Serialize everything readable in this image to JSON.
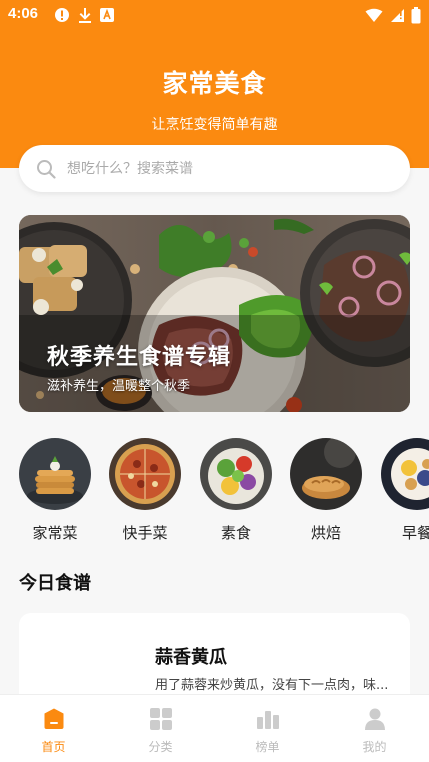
{
  "status_bar": {
    "time": "4:06"
  },
  "header": {
    "title": "家常美食",
    "subtitle": "让烹饪变得简单有趣"
  },
  "search": {
    "placeholder": "想吃什么？搜索菜谱"
  },
  "banner": {
    "title": "秋季养生食谱专辑",
    "subtitle": "滋补养生，温暖整个秋季"
  },
  "categories": [
    {
      "label": "家常菜",
      "icon": "pancake-stack"
    },
    {
      "label": "快手菜",
      "icon": "pizza"
    },
    {
      "label": "素食",
      "icon": "vegetable-bowl"
    },
    {
      "label": "烘焙",
      "icon": "bread"
    },
    {
      "label": "早餐",
      "icon": "breakfast-plate"
    }
  ],
  "today": {
    "section_title": "今日食谱",
    "recipe": {
      "name": "蒜香黄瓜",
      "description": "用了蒜蓉来炒黄瓜，没有下一点肉，味..."
    }
  },
  "tabbar": {
    "items": [
      {
        "label": "首页",
        "icon": "home-icon",
        "active": true
      },
      {
        "label": "分类",
        "icon": "grid-icon",
        "active": false
      },
      {
        "label": "榜单",
        "icon": "ranking-icon",
        "active": false
      },
      {
        "label": "我的",
        "icon": "profile-icon",
        "active": false
      }
    ]
  },
  "colors": {
    "accent": "#fb8a10",
    "background": "#f7f7f7",
    "inactive_tab": "#bbbbbb"
  }
}
